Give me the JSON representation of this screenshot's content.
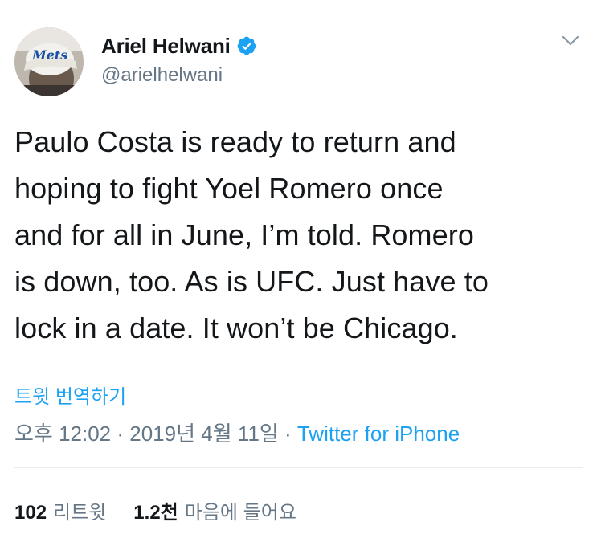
{
  "author": {
    "display_name": "Ariel Helwani",
    "handle": "@arielhelwani",
    "verified": true
  },
  "tweet": {
    "text": "Paulo Costa is ready to return and\nhoping to fight Yoel Romero once\nand for all in June, I’m told. Romero\nis down, too. As is UFC. Just have to\nlock in a date. It won’t be Chicago.",
    "translate_label": "트윗 번역하기",
    "time": "오후 12:02",
    "date": "2019년 4월 11일",
    "separator": " · ",
    "source": "Twitter for iPhone"
  },
  "stats": {
    "retweets_count": "102",
    "retweets_label": "리트윗",
    "likes_count": "1.2천",
    "likes_label": "마음에 들어요"
  },
  "colors": {
    "accent": "#1da1f2",
    "text": "#14171a",
    "secondary": "#657786",
    "divider": "#e6ecf0"
  },
  "icons": {
    "verified": "verified-badge-icon",
    "menu": "chevron-down-icon"
  }
}
